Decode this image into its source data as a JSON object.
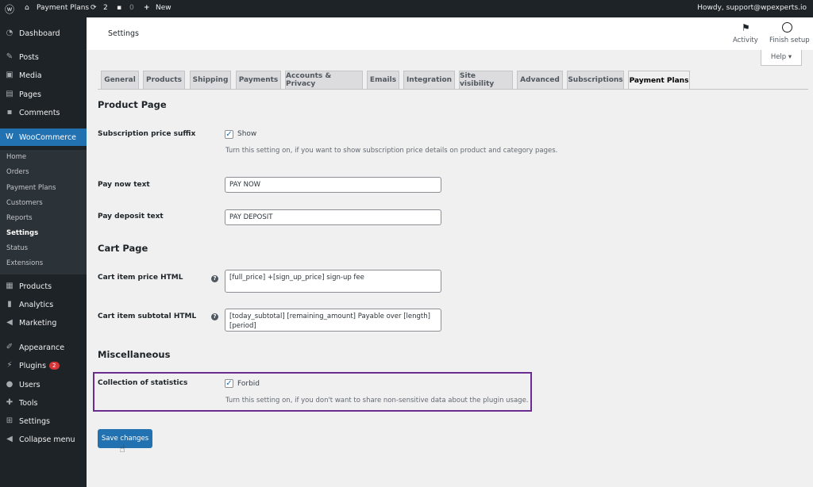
{
  "adminbar": {
    "site": "Payment Plans",
    "updates": "2",
    "comments": "0",
    "new": "New",
    "howdy": "Howdy, support@wpexperts.io"
  },
  "sidebar": {
    "items": [
      {
        "label": "Dashboard",
        "icon": "dashboard-icon"
      },
      {
        "label": "Posts",
        "icon": "pin-icon"
      },
      {
        "label": "Media",
        "icon": "media-icon"
      },
      {
        "label": "Pages",
        "icon": "page-icon"
      },
      {
        "label": "Comments",
        "icon": "comment-icon"
      },
      {
        "label": "WooCommerce",
        "icon": "woo-icon"
      },
      {
        "label": "Products",
        "icon": "archive-icon"
      },
      {
        "label": "Analytics",
        "icon": "chart-icon"
      },
      {
        "label": "Marketing",
        "icon": "megaphone-icon"
      },
      {
        "label": "Appearance",
        "icon": "brush-icon"
      },
      {
        "label": "Plugins",
        "icon": "plugin-icon",
        "badge": "2"
      },
      {
        "label": "Users",
        "icon": "users-icon"
      },
      {
        "label": "Tools",
        "icon": "wrench-icon"
      },
      {
        "label": "Settings",
        "icon": "settings-icon"
      },
      {
        "label": "Collapse menu",
        "icon": "collapse-icon"
      }
    ],
    "submenu": [
      "Home",
      "Orders",
      "Payment Plans",
      "Customers",
      "Reports",
      "Settings",
      "Status",
      "Extensions"
    ]
  },
  "header": {
    "title": "Settings",
    "activity": "Activity",
    "finish": "Finish setup",
    "help": "Help ▾"
  },
  "tabs": [
    "General",
    "Products",
    "Shipping",
    "Payments",
    "Accounts & Privacy",
    "Emails",
    "Integration",
    "Site visibility",
    "Advanced",
    "Subscriptions",
    "Payment Plans"
  ],
  "form": {
    "product_page": "Product Page",
    "suffix_label": "Subscription price suffix",
    "suffix_check": "Show",
    "suffix_desc": "Turn this setting on, if you want to show subscription price details on product and category pages.",
    "pay_now_label": "Pay now text",
    "pay_now_value": "PAY NOW",
    "pay_deposit_label": "Pay deposit text",
    "pay_deposit_value": "PAY DEPOSIT",
    "cart_page": "Cart Page",
    "cart_price_label": "Cart item price HTML",
    "cart_price_value": "[full_price] +[sign_up_price] sign-up fee",
    "cart_subtotal_label": "Cart item subtotal HTML",
    "cart_subtotal_value": "[today_subtotal] [remaining_amount] Payable over [length] [period]",
    "misc": "Miscellaneous",
    "stats_label": "Collection of statistics",
    "stats_check": "Forbid",
    "stats_desc": "Turn this setting on, if you don't want to share non-sensitive data about the plugin usage.",
    "save": "Save changes"
  },
  "colors": {
    "accent": "#2271b1",
    "highlight": "#6b2c91"
  }
}
